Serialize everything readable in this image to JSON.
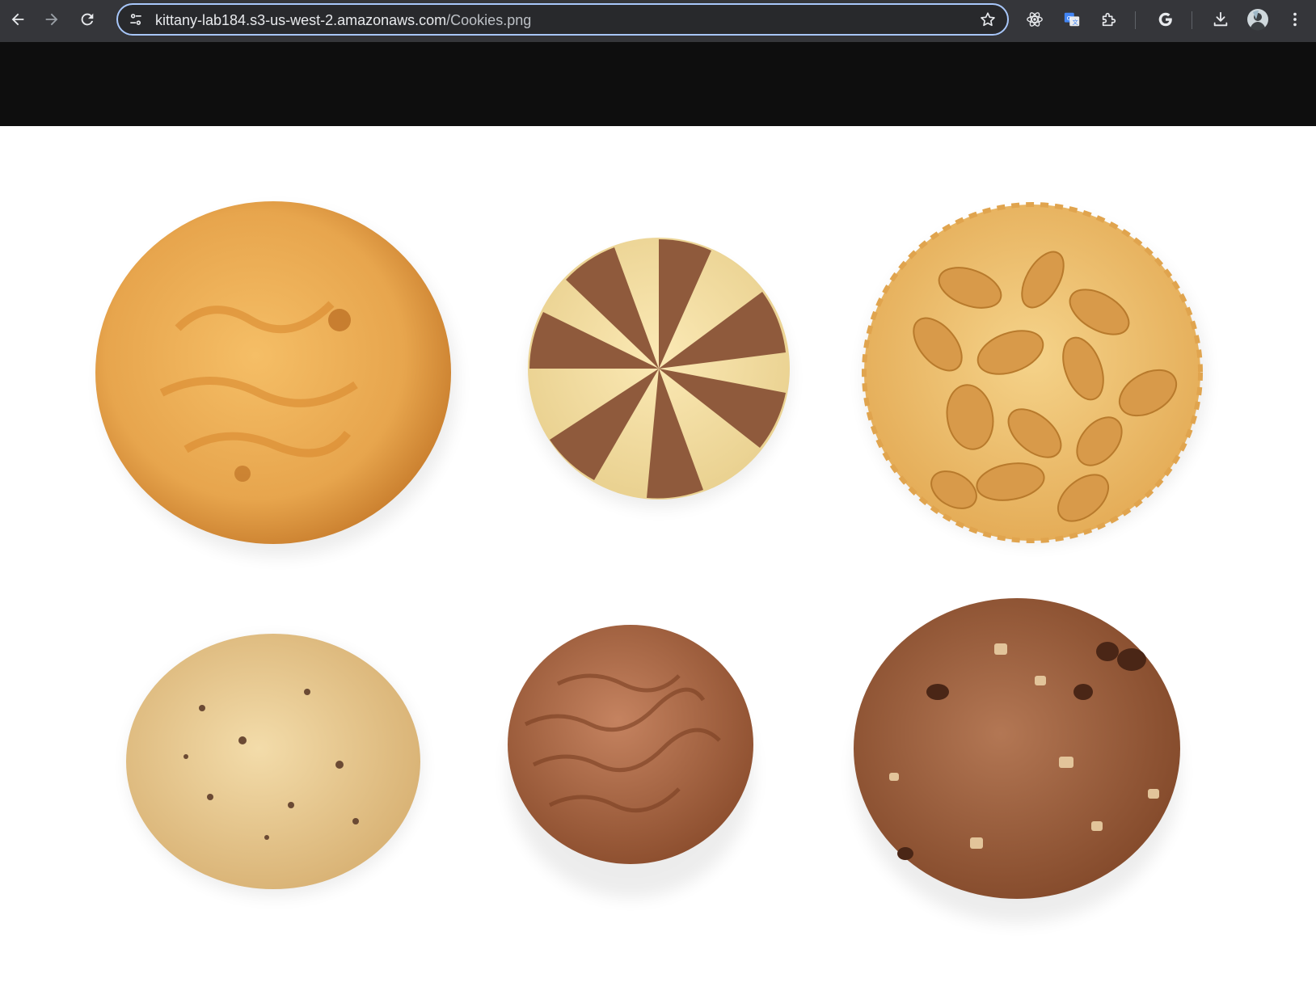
{
  "browser": {
    "url_host": "kittany-lab184.s3-us-west-2.amazonaws.com",
    "url_path": "/Cookies.png",
    "icons": {
      "back": "back-arrow-icon",
      "forward": "forward-arrow-icon",
      "reload": "reload-icon",
      "site_info": "tune-icon",
      "bookmark": "star-icon",
      "react_devtools": "react-atom-icon",
      "translate": "translate-icon",
      "extensions": "puzzle-icon",
      "google": "google-g-icon",
      "downloads": "download-icon",
      "profile": "avatar-icon",
      "menu": "kebab-menu-icon"
    },
    "colors": {
      "toolbar": "#35363a",
      "omnibox_border": "#a8c7fa",
      "page_background": "#0e0e0e",
      "image_background": "#ffffff"
    }
  },
  "image": {
    "subject": "cookies",
    "items": [
      {
        "name": "caramel-swirl-cookie",
        "color": "#e8a34a"
      },
      {
        "name": "pinwheel-cookie",
        "color": "#f2dca0"
      },
      {
        "name": "peanut-cookie",
        "color": "#e9b866"
      },
      {
        "name": "shortbread-cookie",
        "color": "#e8c98f"
      },
      {
        "name": "chocolate-covered-biscuit",
        "color": "#a9663f"
      },
      {
        "name": "chocolate-chip-cookie",
        "color": "#9c5f3c"
      }
    ]
  }
}
